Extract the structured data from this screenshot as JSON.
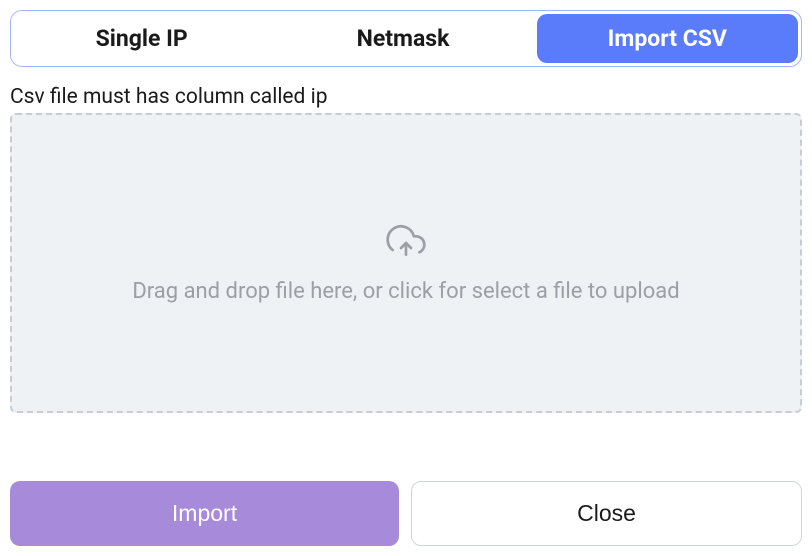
{
  "tabs": [
    {
      "label": "Single IP",
      "active": false
    },
    {
      "label": "Netmask",
      "active": false
    },
    {
      "label": "Import CSV",
      "active": true
    }
  ],
  "hint": "Csv file must has column called ip",
  "dropzone": {
    "text": "Drag and drop file here, or click for select a file to upload",
    "icon": "cloud-upload-icon"
  },
  "buttons": {
    "import_label": "Import",
    "close_label": "Close"
  },
  "colors": {
    "tab_active_bg": "#5b7cfa",
    "btn_primary_bg": "#a78bda",
    "dropzone_bg": "#eef2f5",
    "hint_text": "#9aa0a6"
  }
}
